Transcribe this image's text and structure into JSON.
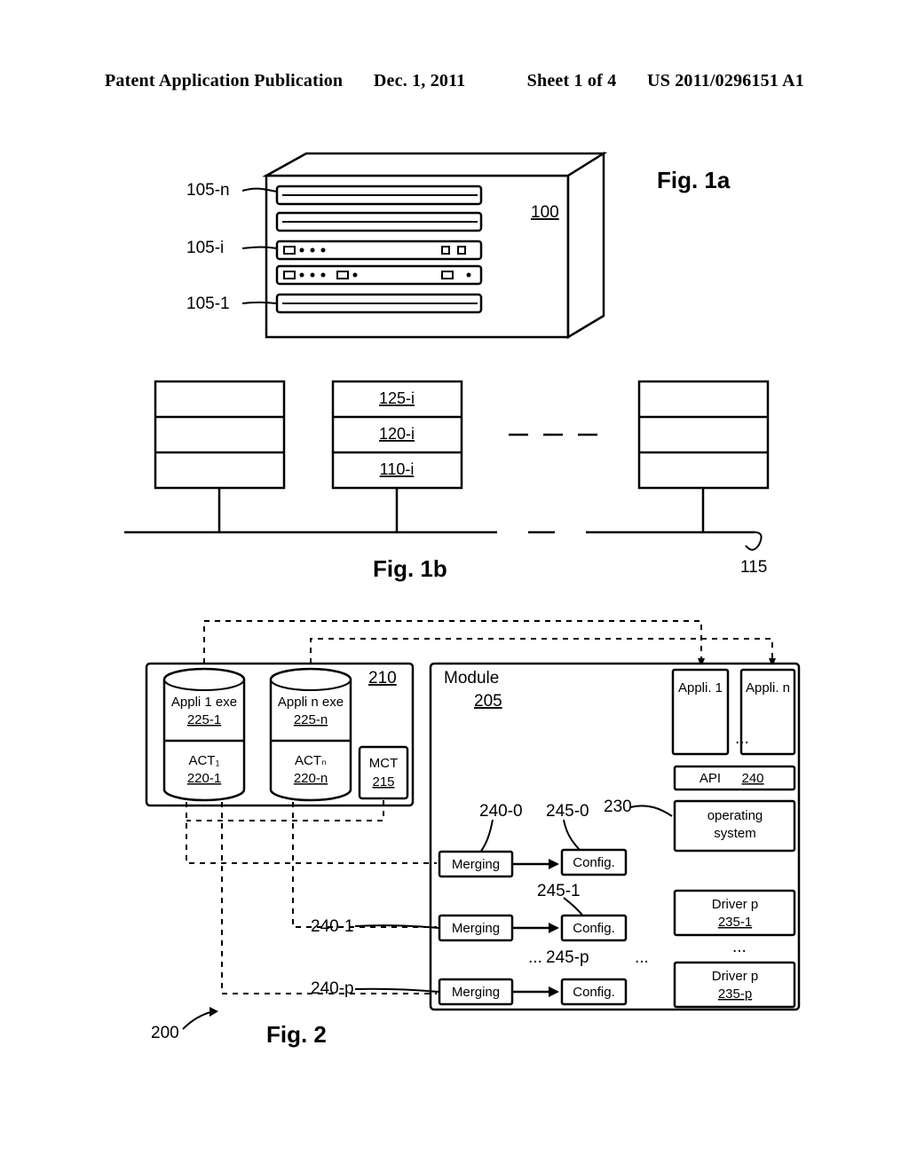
{
  "header": {
    "pubtype": "Patent Application Publication",
    "date": "Dec. 1, 2011",
    "sheet": "Sheet 1 of 4",
    "patno": "US 2011/0296151 A1"
  },
  "fig1a": {
    "label": "Fig. 1a",
    "refs": {
      "r105n": "105-n",
      "r105i": "105-i",
      "r1051": "105-1",
      "r100": "100"
    }
  },
  "fig1b": {
    "label": "Fig. 1b",
    "mid_rows": {
      "top": "125-i",
      "mid": "120-i",
      "bot": "110-i"
    },
    "r115": "115"
  },
  "fig2": {
    "label": "Fig. 2",
    "r200": "200",
    "module": {
      "title": "Module",
      "ref": "205"
    },
    "r210": "210",
    "cyl1": {
      "toplabel": "Appli 1 exe",
      "topref": "225-1",
      "botlabel": "ACT₁",
      "botref": "220-1"
    },
    "cyln": {
      "toplabel": "Appli n exe",
      "topref": "225-n",
      "botlabel": "ACTₙ",
      "botref": "220-n"
    },
    "mct": {
      "label": "MCT",
      "ref": "215"
    },
    "appli1": "Appli. 1",
    "applin": "Appli. n",
    "api": {
      "label": "API",
      "ref": "240"
    },
    "os": "operating system",
    "r230": "230",
    "driver1": {
      "label": "Driver p",
      "ref": "235-1"
    },
    "driverp": {
      "label": "Driver p",
      "ref": "235-p"
    },
    "merge": "Merging",
    "config": "Config.",
    "merge_refs": {
      "m0": "240-0",
      "m1": "240-1",
      "mp": "240-p"
    },
    "config_refs": {
      "c0": "245-0",
      "c1": "245-1",
      "cp": "245-p"
    },
    "ellipsis3": "...",
    "ellipsis_app": "..."
  }
}
